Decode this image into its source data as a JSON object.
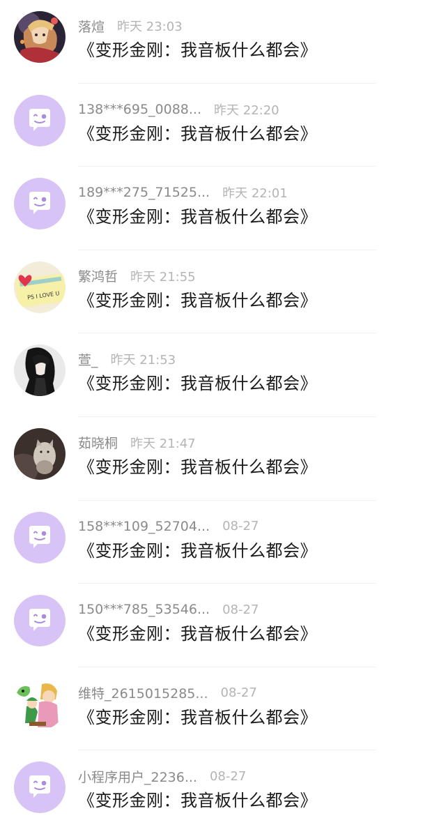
{
  "comments": [
    {
      "user": "落煊",
      "time": "昨天 23:03",
      "text": "《变形金刚：我音板什么都会》",
      "avatar": "anime-photo"
    },
    {
      "user": "138***695_0088...",
      "time": "昨天 22:20",
      "text": "《变形金刚：我音板什么都会》",
      "avatar": "default"
    },
    {
      "user": "189***275_71525...",
      "time": "昨天 22:01",
      "text": "《变形金刚：我音板什么都会》",
      "avatar": "default"
    },
    {
      "user": "繁鸿哲",
      "time": "昨天 21:55",
      "text": "《变形金刚：我音板什么都会》",
      "avatar": "love-note"
    },
    {
      "user": "萱_",
      "time": "昨天 21:53",
      "text": "《变形金刚：我音板什么都会》",
      "avatar": "dark-hair"
    },
    {
      "user": "茹晓桐",
      "time": "昨天 21:47",
      "text": "《变形金刚：我音板什么都会》",
      "avatar": "cat-photo"
    },
    {
      "user": "158***109_52704...",
      "time": "08-27",
      "text": "《变形金刚：我音板什么都会》",
      "avatar": "default"
    },
    {
      "user": "150***785_53546...",
      "time": "08-27",
      "text": "《变形金刚：我音板什么都会》",
      "avatar": "default"
    },
    {
      "user": "维特_2615015285...",
      "time": "08-27",
      "text": "《变形金刚：我音板什么都会》",
      "avatar": "cartoon"
    },
    {
      "user": "小程序用户_2236...",
      "time": "08-27",
      "text": "《变形金刚：我音板什么都会》",
      "avatar": "default"
    }
  ],
  "avatar_note_text": "PS I LOVE U",
  "colors": {
    "default_avatar_bg": "#d7c3f5",
    "default_avatar_eye": "#a98cdc"
  }
}
